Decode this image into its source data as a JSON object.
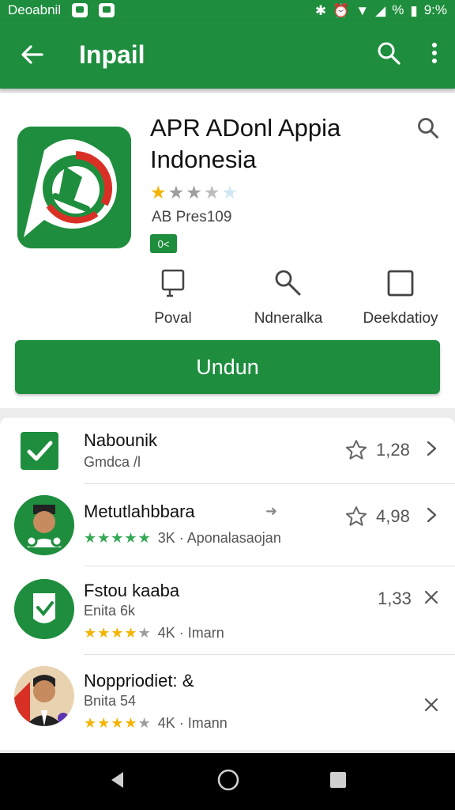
{
  "status_bar": {
    "carrier": "Deoabnil",
    "right_text": "%",
    "battery_text": "9:%"
  },
  "app_bar": {
    "title": "Inpail"
  },
  "app": {
    "title": "APR ADonl Appia Indonesia",
    "rating_stars": 1,
    "meta": "AB Pres109",
    "age_badge": "0<",
    "features": [
      {
        "icon": "phone-icon",
        "label": "Poval"
      },
      {
        "icon": "search-key-icon",
        "label": "Ndneralka"
      },
      {
        "icon": "square-icon",
        "label": "Deekdatioy"
      }
    ],
    "install_label": "Undun"
  },
  "list": [
    {
      "name": "Nabounik",
      "sub": "Gmdca /l",
      "rating": "1,28",
      "trail": "chevron-right-icon"
    },
    {
      "name": "Metutlahbbara",
      "stars_text": "3K · Aponalasaojan",
      "stars": 5,
      "rating": "4,98",
      "trail": "chevron-right-icon"
    },
    {
      "name": "Fstou kaaba",
      "sub": "Enita 6k",
      "stars_text": "4K · Imarn",
      "stars": 4,
      "rating": "1,33",
      "trail": "close-icon"
    },
    {
      "name": "Noppriodiet: &",
      "sub": "Bnita 54",
      "stars_text": "4K · Imann",
      "stars": 4,
      "trail": "close-icon"
    }
  ],
  "colors": {
    "brand_green": "#1e8e3e",
    "star_gold": "#f4b400",
    "star_green": "#34a853"
  }
}
